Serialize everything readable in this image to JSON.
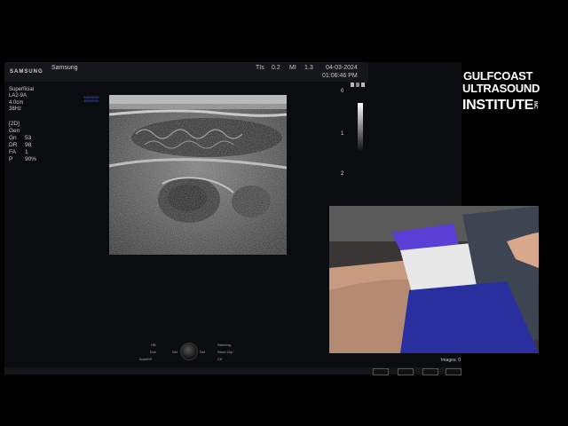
{
  "header": {
    "brand": "SAMSUNG",
    "probe_label": "Samsung",
    "tis_label": "TIs",
    "tis_value": "0.2",
    "mi_label": "MI",
    "mi_value": "1.3",
    "date": "04-03-2024",
    "time": "01:06:46 PM"
  },
  "preset": {
    "lines": [
      "Superficial",
      "LA2-9A",
      "4.0cm",
      "38Hz"
    ]
  },
  "mode_params": {
    "mode": "[2D]",
    "gen": "Gen",
    "rows": [
      {
        "label": "Gn",
        "value": "53"
      },
      {
        "label": "DR",
        "value": "98"
      },
      {
        "label": "FA",
        "value": "1"
      },
      {
        "label": "P",
        "value": "90%"
      }
    ]
  },
  "watermark": {
    "line1": "SAMSUNG",
    "line2": "MEDISON"
  },
  "depth_scale": [
    "0",
    "1",
    "2"
  ],
  "controls": {
    "left": [
      "HB",
      "Exit",
      "AutoIMI"
    ],
    "set_left": "Set",
    "set_right": "Set",
    "right": [
      "Steering",
      "Store Clip",
      "CK"
    ]
  },
  "images_label": "Images",
  "images_count": "0",
  "logo": {
    "line1": "GULFCOAST",
    "line2": "ULTRASOUND",
    "line3": "INSTITUTE",
    "suffix": "INC"
  },
  "colors": {
    "accent_blue": "#4d5fd6",
    "glove": "#5a3fd6",
    "shorts": "#2a2fa0"
  },
  "icons": [
    "trackball-icon",
    "status-icons",
    "gray-scale-bar"
  ]
}
